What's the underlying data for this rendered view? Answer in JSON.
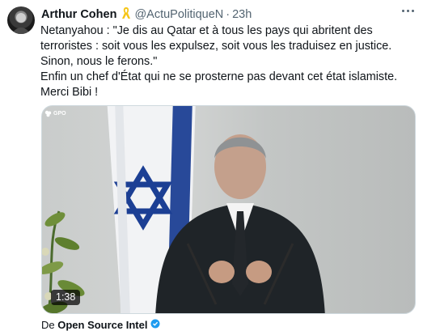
{
  "tweet": {
    "author_name": "Arthur Cohen",
    "handle": "@ActuPolitiqueN",
    "separator": "·",
    "time": "23h",
    "text_line1": "Netanyahou : \"Je dis au Qatar et à tous les pays qui abritent des terroristes : soit vous les expulsez, soit vous les traduisez en justice. Sinon, nous le ferons.\"",
    "text_line2": "Enfin un chef d'État qui ne se prosterne pas devant cet état islamiste. Merci Bibi !"
  },
  "media": {
    "watermark": "GPO",
    "duration": "1:38"
  },
  "quoted": {
    "prefix": "De ",
    "name": "Open Source Intel"
  },
  "colors": {
    "text": "#0f1419",
    "secondary": "#536471",
    "ribbon": "#f5c518",
    "verified": "#1d9bf0",
    "flag_blue": "#1c3f94"
  },
  "icons": {
    "ribbon": "yellow-ribbon-icon",
    "more": "more-options-icon",
    "verified": "verified-badge-icon"
  }
}
